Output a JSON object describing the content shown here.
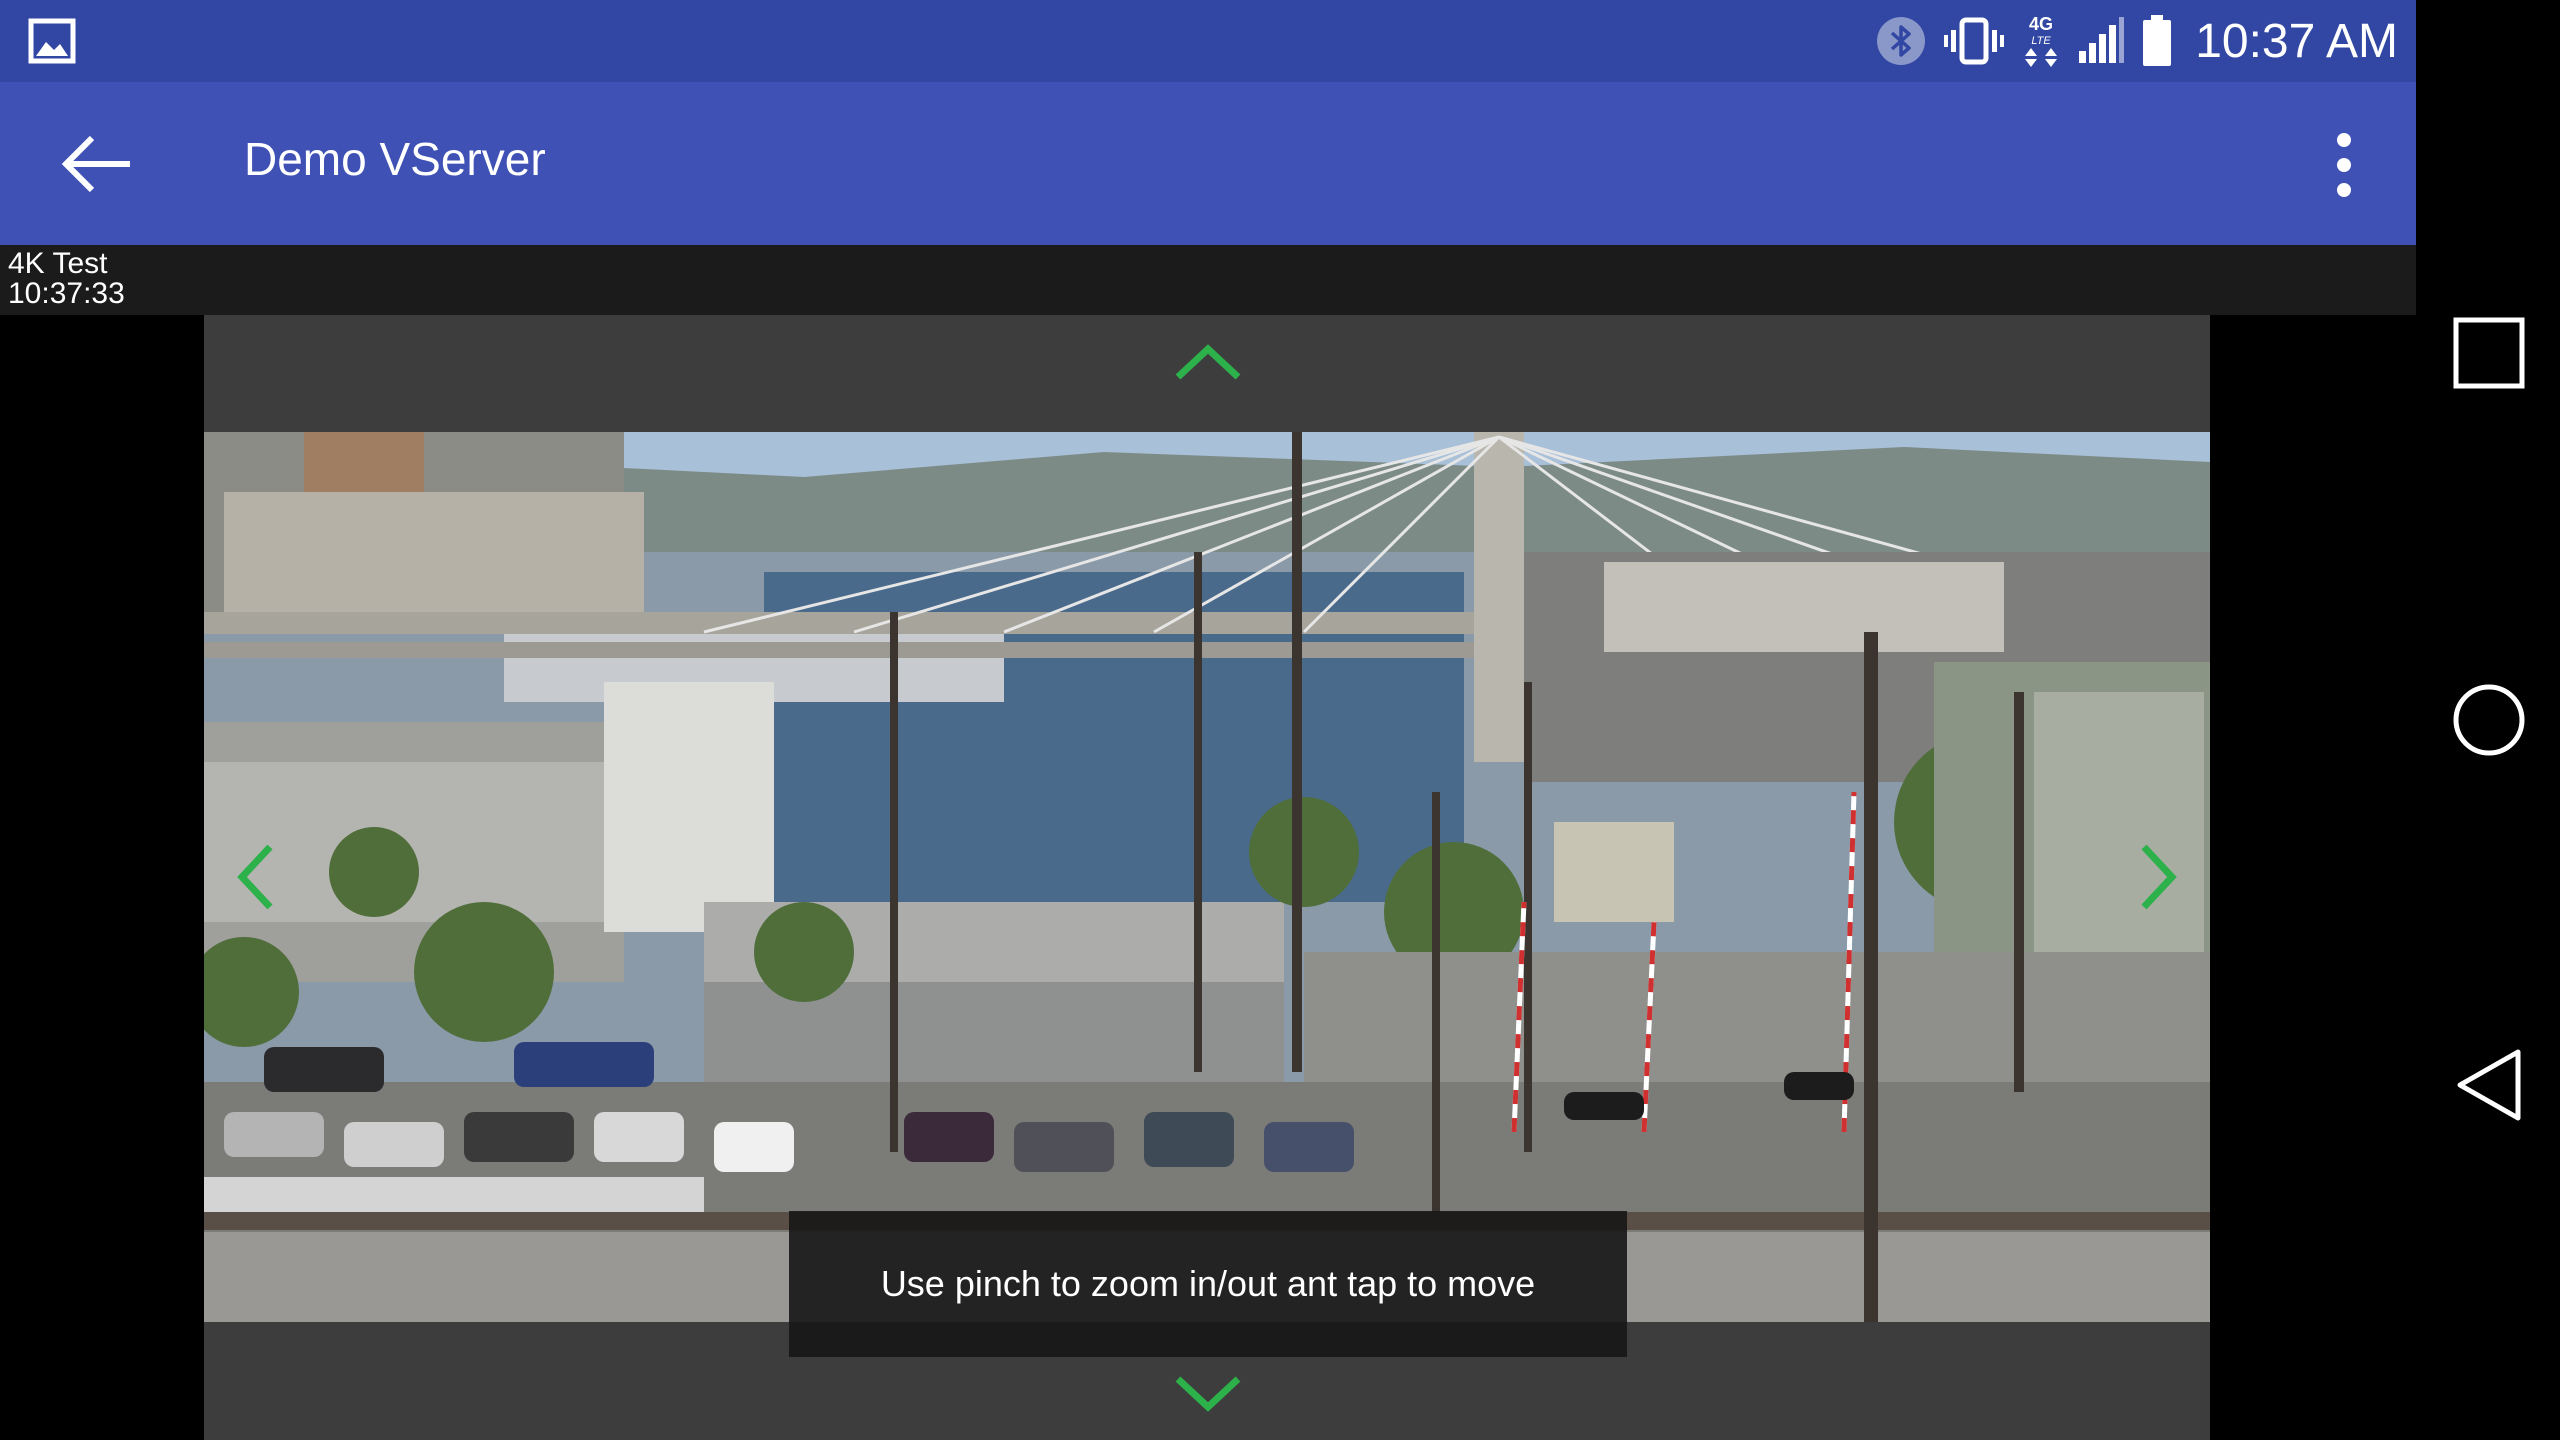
{
  "status_bar": {
    "time": "10:37 AM",
    "network_label": "4G",
    "network_sub_label": "LTE",
    "icons": [
      "image-notification-icon",
      "bluetooth-icon",
      "vibrate-icon",
      "lte-data-icon",
      "signal-icon",
      "battery-icon"
    ]
  },
  "toolbar": {
    "title": "Demo VServer",
    "back_icon": "arrow-left-icon",
    "menu_icon": "more-vert-icon"
  },
  "camera": {
    "name": "4K Test",
    "timestamp": "10:37:33"
  },
  "ptz": {
    "color": "#2db14a",
    "icons": [
      "chevron-up-icon",
      "chevron-down-icon",
      "chevron-left-icon",
      "chevron-right-icon"
    ]
  },
  "toast": {
    "message": "Use pinch to zoom in/out ant tap to move"
  },
  "nav_bar": {
    "icons": [
      "recents-square-icon",
      "home-circle-icon",
      "back-triangle-icon"
    ]
  },
  "colors": {
    "status_bar": "#3147a3",
    "toolbar": "#3f51b5",
    "viewer_background": "#3d3d3d"
  }
}
